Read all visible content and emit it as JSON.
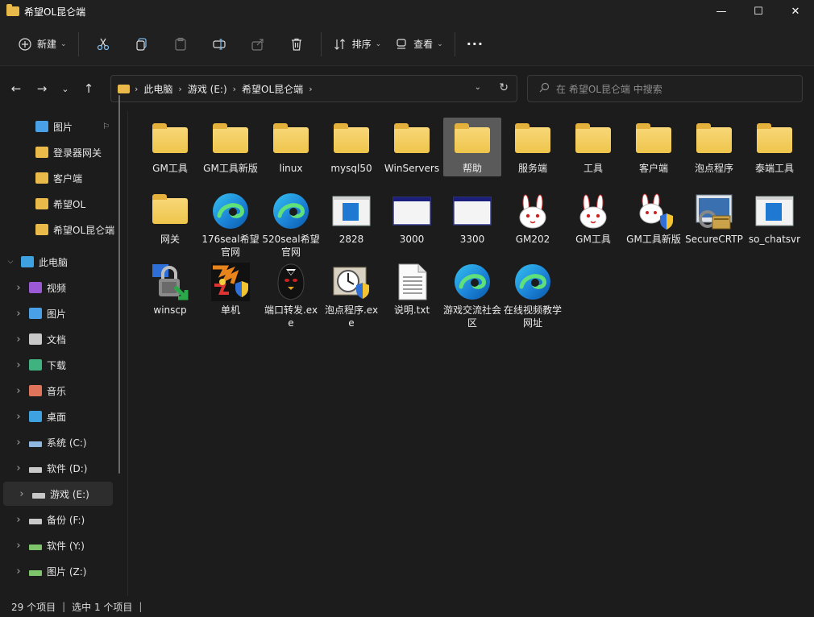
{
  "window": {
    "title": "希望OL昆仑端",
    "controls": [
      "minimize-icon",
      "maximize-icon",
      "close-icon"
    ]
  },
  "toolbar": {
    "new_label": "新建",
    "sort_label": "排序",
    "view_label": "查看",
    "more_label": "···"
  },
  "address": {
    "crumbs": [
      "此电脑",
      "游戏 (E:)",
      "希望OL昆仑端"
    ],
    "search_placeholder": "在 希望OL昆仑端 中搜索"
  },
  "nav": {
    "items": [
      {
        "label": "图片",
        "icon": "pictures-icon",
        "color": "#4aa0e6",
        "pinned": true
      },
      {
        "label": "登录器网关",
        "icon": "folder-icon",
        "color": "#e9b949"
      },
      {
        "label": "客户端",
        "icon": "folder-icon",
        "color": "#e9b949"
      },
      {
        "label": "希望OL",
        "icon": "folder-icon",
        "color": "#e9b949"
      },
      {
        "label": "希望OL昆仑端",
        "icon": "folder-icon",
        "color": "#e9b949"
      },
      {
        "label": "此电脑",
        "icon": "computer-icon",
        "color": "#3fa2e0"
      },
      {
        "label": "视频",
        "icon": "videos-icon",
        "color": "#9b59d6"
      },
      {
        "label": "图片",
        "icon": "pictures-icon",
        "color": "#4aa0e6"
      },
      {
        "label": "文档",
        "icon": "documents-icon",
        "color": "#c8c8c8"
      },
      {
        "label": "下载",
        "icon": "downloads-icon",
        "color": "#3fb27f"
      },
      {
        "label": "音乐",
        "icon": "music-icon",
        "color": "#e0745a"
      },
      {
        "label": "桌面",
        "icon": "desktop-icon",
        "color": "#3fa2e0"
      },
      {
        "label": "系统 (C:)",
        "icon": "drive-icon",
        "color": "#8fb8e0"
      },
      {
        "label": "软件 (D:)",
        "icon": "drive-icon",
        "color": "#c8c8c8"
      },
      {
        "label": "游戏 (E:)",
        "icon": "drive-icon",
        "color": "#c8c8c8"
      },
      {
        "label": "备份 (F:)",
        "icon": "drive-icon",
        "color": "#c8c8c8"
      },
      {
        "label": "软件 (Y:)",
        "icon": "drive-icon",
        "color": "#7dc46a"
      },
      {
        "label": "图片 (Z:)",
        "icon": "drive-icon",
        "color": "#7dc46a"
      }
    ]
  },
  "files": [
    {
      "label": "GM工具",
      "type": "folder"
    },
    {
      "label": "GM工具新版",
      "type": "folder"
    },
    {
      "label": "linux",
      "type": "folder"
    },
    {
      "label": "mysql50",
      "type": "folder"
    },
    {
      "label": "WinServers",
      "type": "folder"
    },
    {
      "label": "帮助",
      "type": "folder",
      "selected": true
    },
    {
      "label": "服务端",
      "type": "folder"
    },
    {
      "label": "工具",
      "type": "folder"
    },
    {
      "label": "客户端",
      "type": "folder"
    },
    {
      "label": "泡点程序",
      "type": "folder"
    },
    {
      "label": "泰端工具",
      "type": "folder"
    },
    {
      "label": "网关",
      "type": "folder"
    },
    {
      "label": "176seal希望官网",
      "type": "edge"
    },
    {
      "label": "520seal希望官网",
      "type": "edge"
    },
    {
      "label": "2828",
      "type": "appwin"
    },
    {
      "label": "3000",
      "type": "window"
    },
    {
      "label": "3300",
      "type": "window"
    },
    {
      "label": "GM202",
      "type": "rabbit"
    },
    {
      "label": "GM工具",
      "type": "rabbit"
    },
    {
      "label": "GM工具新版",
      "type": "rabbit-shield"
    },
    {
      "label": "SecureCRTP",
      "type": "securecrt"
    },
    {
      "label": "so_chatsvr",
      "type": "appwin"
    },
    {
      "label": "winscp",
      "type": "winscp"
    },
    {
      "label": "单机",
      "type": "game"
    },
    {
      "label": "端口转发.exe",
      "type": "penguin"
    },
    {
      "label": "泡点程序.exe",
      "type": "clock"
    },
    {
      "label": "说明.txt",
      "type": "txt"
    },
    {
      "label": "游戏交流社会区",
      "type": "edge"
    },
    {
      "label": "在线视频教学网址",
      "type": "edge"
    }
  ],
  "status": {
    "count": "29 个项目",
    "selected": "选中 1 个项目"
  }
}
